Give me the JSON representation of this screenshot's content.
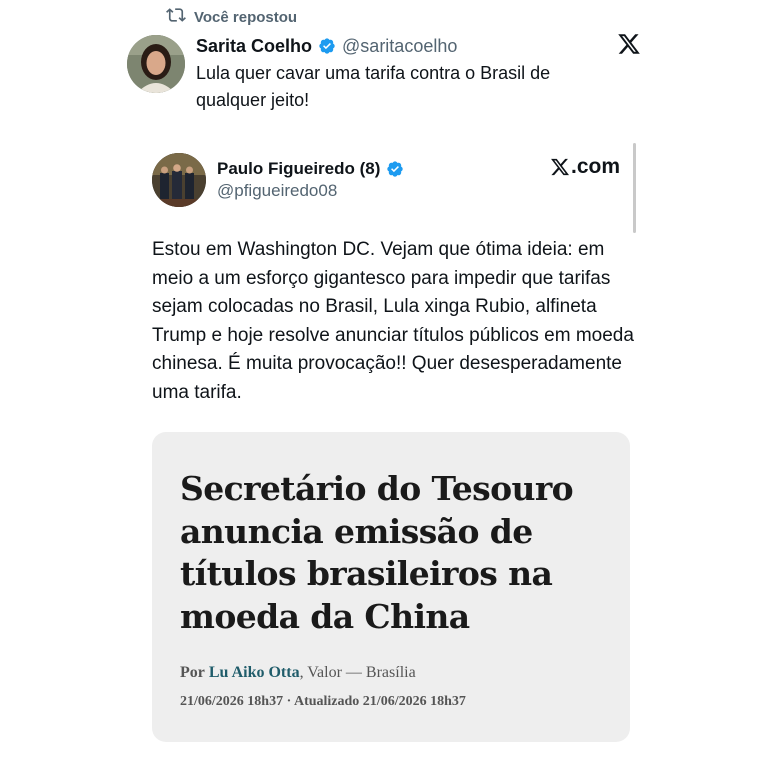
{
  "repost": {
    "label": "Você repostou"
  },
  "outer_post": {
    "author_name": "Sarita Coelho",
    "handle": "@saritacoelho",
    "text": "Lula quer cavar uma tarifa contra o Brasil de qualquer jeito!"
  },
  "embedded_post": {
    "author_name": "Paulo Figueiredo (8)",
    "handle": "@pfigueiredo08",
    "source_label": ".com",
    "text": "Estou em Washington DC. Vejam que ótima ideia: em meio a um esforço gigantesco para impedir que tarifas sejam colocadas no Brasil, Lula xinga Rubio, alfineta Trump e hoje resolve anunciar títulos públicos em moeda chinesa. É muita provocação!! Quer desesperadamente uma tarifa."
  },
  "news_card": {
    "headline": "Secretário do Tesouro anuncia emissão de títulos brasileiros na moeda da China",
    "byline_prefix": "Por",
    "author": "Lu Aiko Otta",
    "outlet": ", Valor — Brasília",
    "dateline": "21/06/2026 18h37 · Atualizado 21/06/2026 18h37"
  },
  "colors": {
    "verified_blue": "#1d9bf0",
    "secondary_text": "#536471",
    "card_bg": "#eeeeee",
    "author_link": "#1f5c6a"
  },
  "icons": {
    "repost": "repost-icon",
    "verified": "verified-badge-icon",
    "x_logo": "x-logo-icon"
  }
}
